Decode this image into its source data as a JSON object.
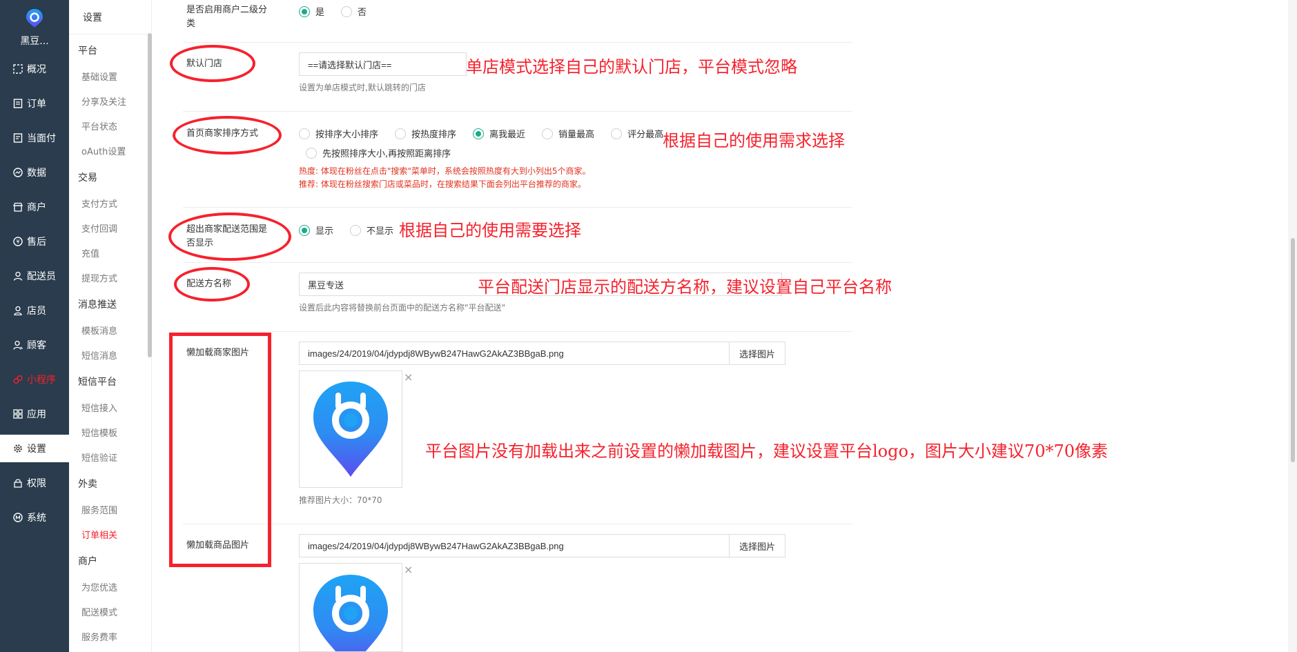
{
  "sidebar": {
    "brand": "黑豆...",
    "items": [
      {
        "label": "概况",
        "icon": "overview-icon"
      },
      {
        "label": "订单",
        "icon": "order-icon"
      },
      {
        "label": "当面付",
        "icon": "face-pay-icon"
      },
      {
        "label": "数据",
        "icon": "data-icon"
      },
      {
        "label": "商户",
        "icon": "store-icon"
      },
      {
        "label": "售后",
        "icon": "after-sale-icon"
      },
      {
        "label": "配送员",
        "icon": "courier-icon"
      },
      {
        "label": "店员",
        "icon": "clerk-icon"
      },
      {
        "label": "顾客",
        "icon": "customer-icon"
      },
      {
        "label": "小程序",
        "icon": "miniprogram-icon"
      },
      {
        "label": "应用",
        "icon": "apps-icon"
      },
      {
        "label": "设置",
        "icon": "gear-icon"
      },
      {
        "label": "权限",
        "icon": "lock-icon"
      },
      {
        "label": "系统",
        "icon": "system-icon"
      }
    ],
    "active": "设置",
    "highlight_color": "#f5222d"
  },
  "subnav": {
    "title": "设置",
    "groups": [
      {
        "title": "平台",
        "items": [
          "基础设置",
          "分享及关注",
          "平台状态",
          "oAuth设置"
        ]
      },
      {
        "title": "交易",
        "items": [
          "支付方式",
          "支付回调",
          "充值",
          "提现方式"
        ]
      },
      {
        "title": "消息推送",
        "items": [
          "模板消息",
          "短信消息"
        ]
      },
      {
        "title": "短信平台",
        "items": [
          "短信接入",
          "短信模板",
          "短信验证"
        ]
      },
      {
        "title": "外卖",
        "items": [
          "服务范围",
          "订单相关"
        ]
      },
      {
        "title": "商户",
        "items": [
          "为您优选",
          "配送模式",
          "服务费率"
        ]
      }
    ],
    "active_item": "订单相关"
  },
  "form": {
    "sub_category": {
      "label": "是否启用商户二级分类",
      "label_line1": "是否启用商户二级分",
      "label_line2": "类",
      "options": [
        "是",
        "否"
      ],
      "selected": "是"
    },
    "default_store": {
      "label": "默认门店",
      "placeholder": "==请选择默认门店==",
      "help": "设置为单店模式时,默认跳转的门店"
    },
    "home_sort": {
      "label": "首页商家排序方式",
      "options": [
        "按排序大小排序",
        "按热度排序",
        "离我最近",
        "销量最高",
        "评分最高",
        "先按照排序大小,再按照距离排序"
      ],
      "selected": "离我最近",
      "help_hot": "热度: 体现在粉丝在点击\"搜索\"菜单时，系统会按照热度有大到小列出5个商家。",
      "help_recommend": "推荐: 体现在粉丝搜索门店或菜品时，在搜索结果下面会列出平台推荐的商家。"
    },
    "out_of_range": {
      "label": "超出商家配送范围是否显示",
      "label_line1": "超出商家配送范围是",
      "label_line2": "否显示",
      "options": [
        "显示",
        "不显示"
      ],
      "selected": "显示"
    },
    "delivery_name": {
      "label": "配送方名称",
      "value": "黑豆专送",
      "help": "设置后此内容将替换前台页面中的配送方名称\"平台配送\""
    },
    "lazy_store_img": {
      "label": "懒加载商家图片",
      "path": "images/24/2019/04/jdypdj8WBywB247HawG2AkAZ3BBgaB.png",
      "button": "选择图片",
      "close": "×",
      "help": "推荐图片大小：70*70"
    },
    "lazy_goods_img": {
      "label": "懒加载商品图片",
      "path": "images/24/2019/04/jdypdj8WBywB247HawG2AkAZ3BBgaB.png",
      "button": "选择图片",
      "close": "×"
    }
  },
  "annotations": {
    "default_store": "单店模式选择自己的默认门店，平台模式忽略",
    "home_sort": "根据自己的使用需求选择",
    "out_of_range": "根据自己的使用需要选择",
    "delivery_name": "平台配送门店显示的配送方名称，建议设置自己平台名称",
    "lazy_img": "平台图片没有加载出来之前设置的懒加载图片，建议设置平台logo，图片大小建议70*70像素",
    "color": "#f5222d"
  },
  "colors": {
    "sidebar_bg": "#2a3c4d",
    "radio_checked": "#1aab8a"
  }
}
